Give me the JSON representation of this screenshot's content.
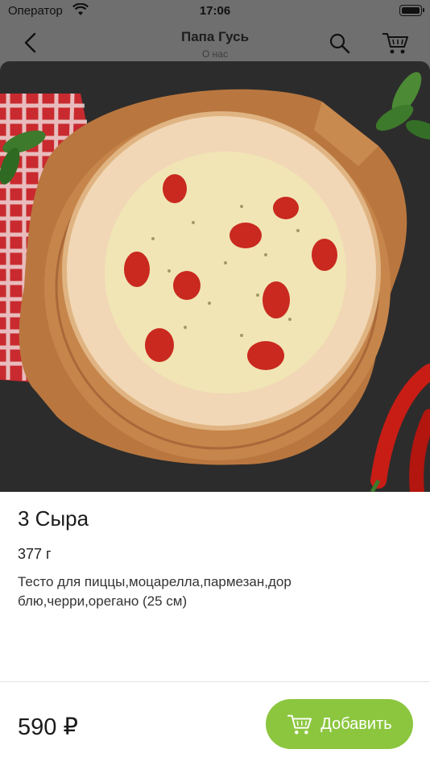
{
  "status_bar": {
    "carrier": "Оператор",
    "time": "17:06"
  },
  "header": {
    "title": "Папа Гусь",
    "subtitle": "О нас"
  },
  "product": {
    "name": "3 Сыра",
    "weight": "377 г",
    "description": "Тесто для пиццы,моцарелла,пармезан,дор блю,черри,орегано (25 см)",
    "price": "590 ₽"
  },
  "actions": {
    "add_label": "Добавить"
  },
  "colors": {
    "accent": "#8cc63f",
    "overlay": "#6f6f6f"
  }
}
